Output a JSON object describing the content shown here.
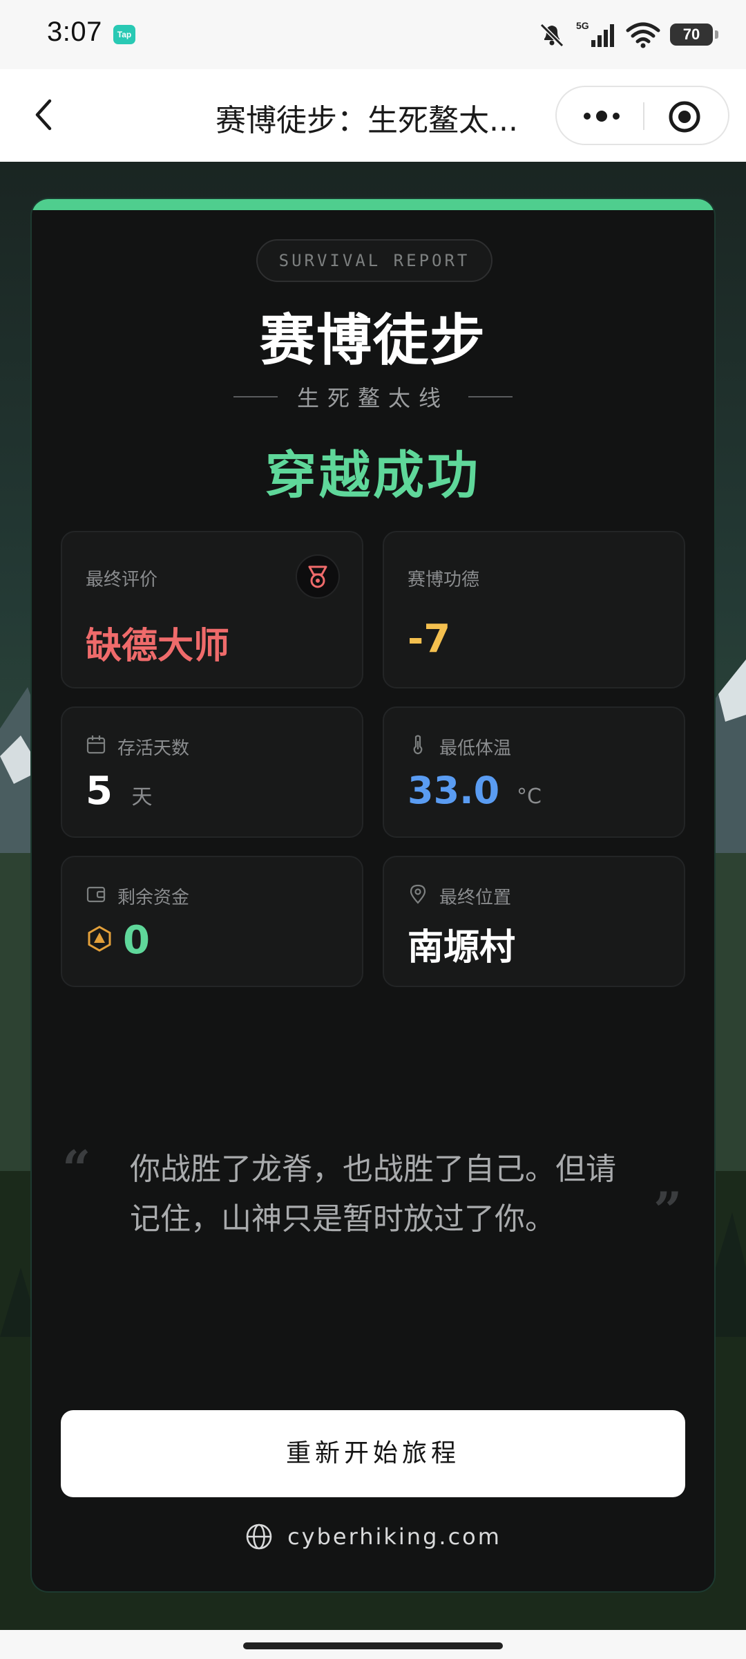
{
  "status_bar": {
    "time": "3:07",
    "app_badge": "Tap",
    "network": "5G",
    "battery": "70"
  },
  "nav": {
    "title": "赛博徒步：生死鳌太..."
  },
  "card": {
    "badge": "SURVIVAL REPORT",
    "title": "赛博徒步",
    "subtitle": "生死鳌太线",
    "result": "穿越成功",
    "stats": {
      "final_rating": {
        "label": "最终评价",
        "value": "缺德大师"
      },
      "cyber_merit": {
        "label": "赛博功德",
        "value": "-7"
      },
      "days_survived": {
        "label": "存活天数",
        "value": "5",
        "unit": "天"
      },
      "min_temp": {
        "label": "最低体温",
        "value": "33.0",
        "unit": "°C"
      },
      "funds_left": {
        "label": "剩余资金",
        "value": "0"
      },
      "final_location": {
        "label": "最终位置",
        "value": "南塬村"
      }
    },
    "quote": "你战胜了龙脊，也战胜了自己。但请记住，山神只是暂时放过了你。",
    "quote_open": "“",
    "quote_close": "”",
    "restart_button": "重新开始旅程",
    "site": "cyberhiking.com"
  },
  "colors": {
    "accent_green": "#5fd79a",
    "rating_red": "#ef6b6b",
    "merit_gold": "#f4c04f",
    "temp_blue": "#5a9cf2",
    "funds_green": "#5fd79a"
  }
}
